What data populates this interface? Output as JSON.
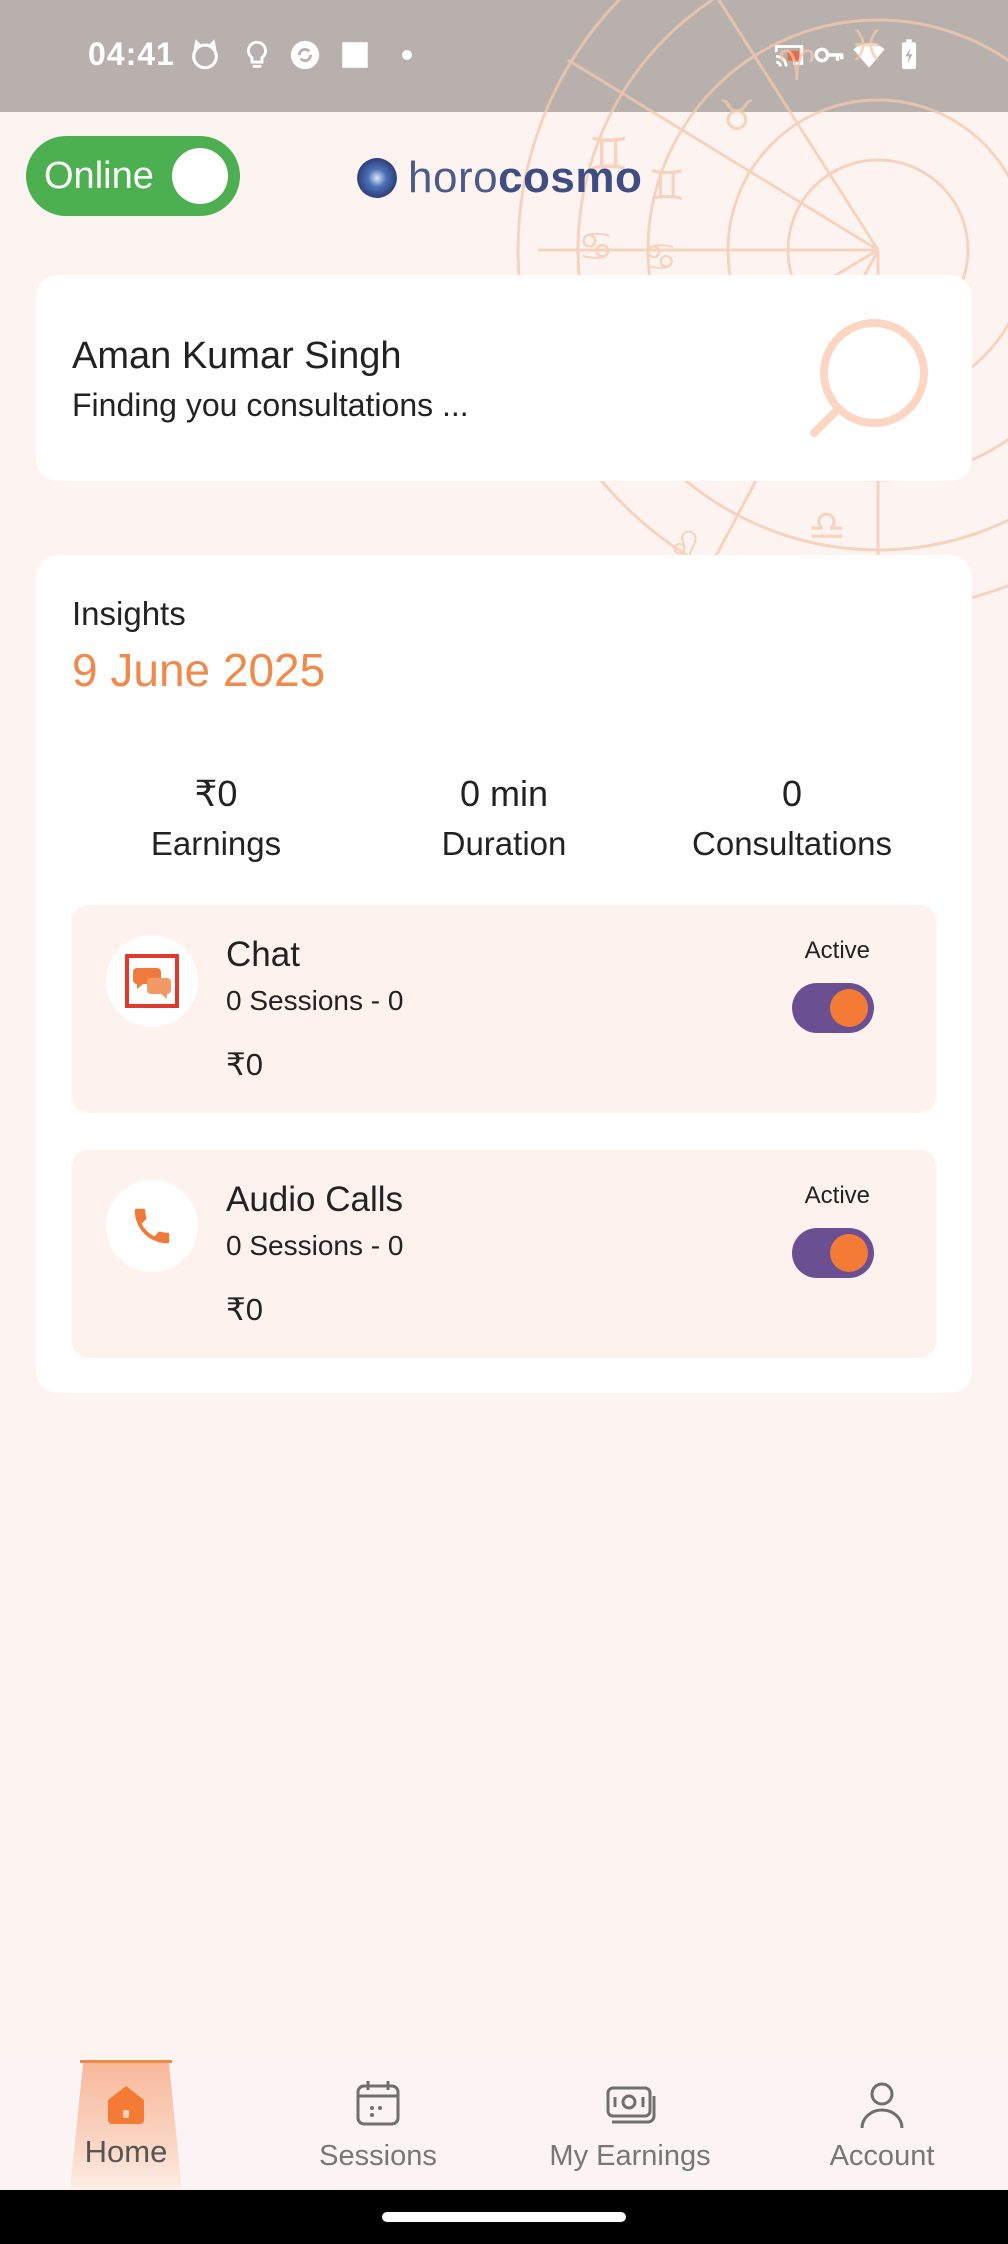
{
  "status_bar": {
    "time": "04:41",
    "left_icons": [
      "cat-face-icon",
      "lightbulb-icon",
      "sync-app-icon",
      "square-icon",
      "dot-icon"
    ],
    "right_icons": [
      "cast-icon",
      "vpn-key-icon",
      "wifi-icon",
      "battery-charging-icon"
    ]
  },
  "header": {
    "online_label": "Online",
    "online_on": true,
    "brand_light": "horo",
    "brand_bold": "cosmo"
  },
  "profile": {
    "name": "Aman Kumar Singh",
    "status": "Finding you consultations ..."
  },
  "insights": {
    "label": "Insights",
    "date": "9 June 2025",
    "stats": [
      {
        "value": "₹0",
        "label": "Earnings"
      },
      {
        "value": "0 min",
        "label": "Duration"
      },
      {
        "value": "0",
        "label": "Consultations"
      }
    ]
  },
  "services": [
    {
      "title": "Chat",
      "sessions": "0 Sessions - 0",
      "earnings": "₹0",
      "status_label": "Active",
      "active": true,
      "icon": "chat-bubbles-icon"
    },
    {
      "title": "Audio Calls",
      "sessions": "0 Sessions - 0",
      "earnings": "₹0",
      "status_label": "Active",
      "active": true,
      "icon": "phone-icon"
    }
  ],
  "nav": {
    "items": [
      {
        "label": "Home",
        "icon": "home-icon",
        "active": true
      },
      {
        "label": "Sessions",
        "icon": "calendar-icon",
        "active": false
      },
      {
        "label": "My Earnings",
        "icon": "money-icon",
        "active": false
      },
      {
        "label": "Account",
        "icon": "user-icon",
        "active": false
      }
    ]
  },
  "colors": {
    "accent": "#f08a4b",
    "online_green": "#4caf50",
    "toggle_purple": "#6a4f93",
    "toggle_knob": "#f47b35",
    "page_bg": "#fdf4f1"
  }
}
